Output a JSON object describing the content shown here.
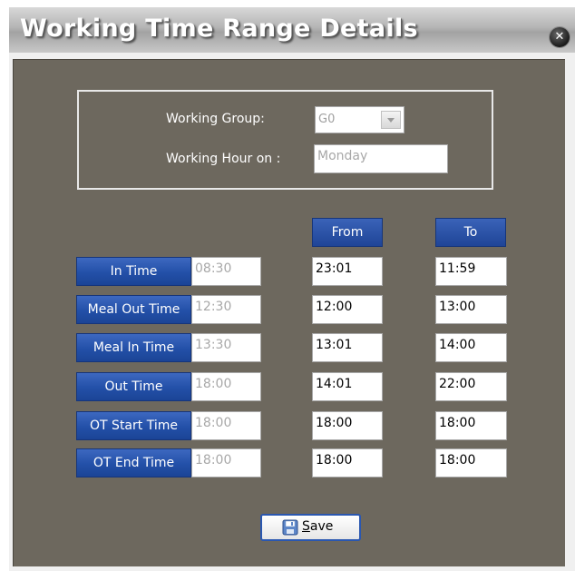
{
  "window": {
    "title": "Working Time Range Details"
  },
  "form": {
    "working_group_label": "Working Group:",
    "working_group_value": "G0",
    "working_hour_label": "Working Hour on :",
    "working_hour_value": "Monday"
  },
  "columns": {
    "from": "From",
    "to": "To"
  },
  "rows": [
    {
      "label": "In Time",
      "default": "08:30",
      "from": "23:01",
      "to": "11:59"
    },
    {
      "label": "Meal Out Time",
      "default": "12:30",
      "from": "12:00",
      "to": "13:00"
    },
    {
      "label": "Meal In Time",
      "default": "13:30",
      "from": "13:01",
      "to": "14:00"
    },
    {
      "label": "Out Time",
      "default": "18:00",
      "from": "14:01",
      "to": "22:00"
    },
    {
      "label": "OT Start Time",
      "default": "18:00",
      "from": "18:00",
      "to": "18:00"
    },
    {
      "label": "OT End Time",
      "default": "18:00",
      "from": "18:00",
      "to": "18:00"
    }
  ],
  "save": {
    "mnemonic": "S",
    "rest": "ave"
  },
  "icons": {
    "close": "close-icon",
    "save": "save-icon"
  }
}
